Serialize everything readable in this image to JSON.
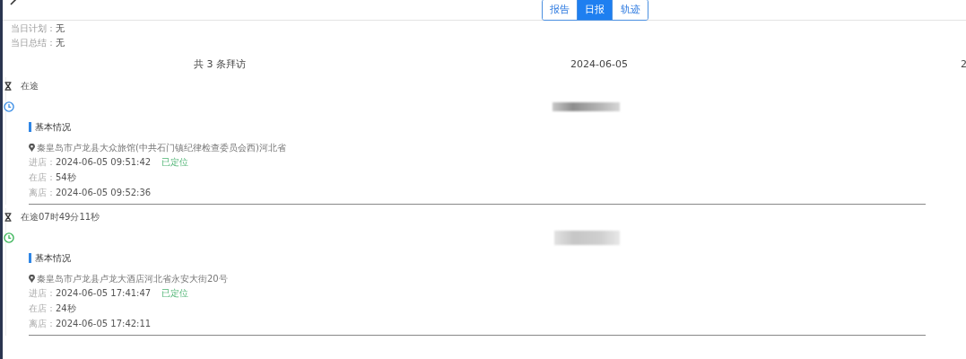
{
  "tabs": [
    {
      "label": "报告",
      "selected": false
    },
    {
      "label": "日报",
      "selected": true
    },
    {
      "label": "轨迹",
      "selected": false
    }
  ],
  "daily_plan": {
    "label": "当日计划：",
    "value": "无"
  },
  "daily_summary": {
    "label": "当日总结：",
    "value": "无"
  },
  "summary_row": {
    "count": "共 3 条拜访",
    "date": "2024-06-05",
    "column_3": "2"
  },
  "visits": [
    {
      "transit": "在途",
      "color": "#3d8fe6",
      "section_title": "基本情况",
      "address": "秦皇岛市卢龙县大众旅馆(中共石门镇纪律检查委员会西)河北省",
      "fields": [
        {
          "label": "进店：",
          "value": "2024-06-05 09:51:42",
          "badge": "已定位"
        },
        {
          "label": "在店：",
          "value": "54秒"
        },
        {
          "label": "离店：",
          "value": "2024-06-05 09:52:36"
        }
      ]
    },
    {
      "transit": "在途07时49分11秒",
      "color": "#3cb55a",
      "section_title": "基本情况",
      "address": "秦皇岛市卢龙县卢龙大酒店河北省永安大街20号",
      "fields": [
        {
          "label": "进店：",
          "value": "2024-06-05 17:41:47",
          "badge": "已定位"
        },
        {
          "label": "在店：",
          "value": "24秒"
        },
        {
          "label": "离店：",
          "value": "2024-06-05 17:42:11"
        }
      ]
    }
  ]
}
